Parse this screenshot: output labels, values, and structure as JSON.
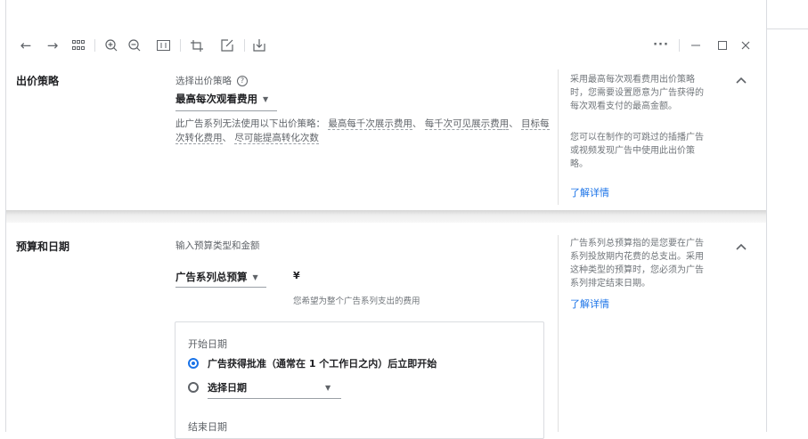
{
  "toolbar": {
    "icons": [
      "back-arrow-icon",
      "forward-arrow-icon",
      "grid-icon",
      "zoom-in-icon",
      "zoom-out-icon",
      "fit-icon",
      "crop-icon",
      "edit-icon",
      "save-icon"
    ],
    "window": [
      "more-icon",
      "minimize-icon",
      "maximize-icon",
      "close-icon"
    ]
  },
  "bid": {
    "title": "出价策略",
    "select_label": "选择出价策略",
    "selected": "最高每次观看费用",
    "note_prefix": "此广告系列无法使用以下出价策略：",
    "options": [
      "最高每千次展示费用",
      "每千次可见展示费",
      "用",
      "目标每次转化费用",
      "尽可能提高转化次数"
    ],
    "sep": "、",
    "side_p1_lines": [
      "采用最高每次观看费用出价策略",
      "时，您需要设置愿意为广告获得的",
      "每次观看支付的最高金额。"
    ],
    "side_p2_lines": [
      "您可以在制作的可跳过的插播广告",
      "或视频发现广告中使用此出价策",
      "略。"
    ],
    "learn_more": "了解详情"
  },
  "budget": {
    "title": "预算和日期",
    "input_label": "输入预算类型和金额",
    "budget_type": "广告系列总预算",
    "currency": "¥",
    "hint": "您希望为整个广告系列支出的费用",
    "side_lines": [
      "广告系列总预算指的是您要在广告",
      "系列投放期内花费的总支出。采用",
      "这种类型的预算时，您必须为广告",
      "系列排定结束日期。"
    ],
    "learn_more": "了解详情",
    "start_label": "开始日期",
    "start_option_1": "广告获得批准（通常在 1 个工作日之内）后立即开始",
    "start_option_2": "选择日期",
    "end_label": "结束日期"
  },
  "colors": {
    "accent": "#1a73e8",
    "text": "#202124",
    "muted": "#5f6368"
  }
}
